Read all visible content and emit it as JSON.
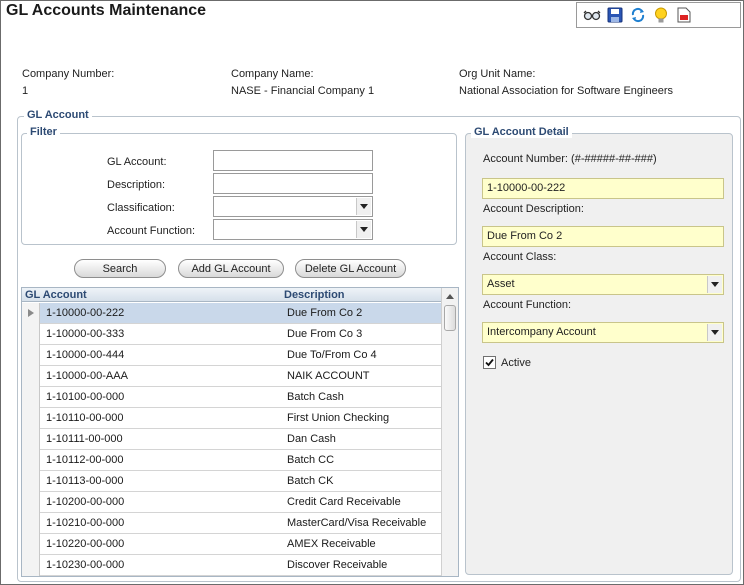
{
  "title": "GL Accounts Maintenance",
  "toolbar": {
    "icons": [
      "glasses-icon",
      "save-icon",
      "refresh-icon",
      "lightbulb-icon",
      "document-icon"
    ]
  },
  "company": {
    "number_label": "Company Number:",
    "number": "1",
    "name_label": "Company Name:",
    "name": "NASE - Financial Company 1",
    "org_label": "Org Unit Name:",
    "org": "National Association for Software Engineers"
  },
  "gl_account_group": "GL Account",
  "filter": {
    "legend": "Filter",
    "gl_account_label": "GL Account:",
    "gl_account_value": "",
    "description_label": "Description:",
    "description_value": "",
    "classification_label": "Classification:",
    "classification_value": "",
    "account_function_label": "Account Function:",
    "account_function_value": ""
  },
  "buttons": {
    "search": "Search",
    "add": "Add GL Account",
    "delete": "Delete GL Account"
  },
  "grid": {
    "columns": [
      "GL Account",
      "Description"
    ],
    "rows": [
      [
        "1-10000-00-222",
        "Due From Co 2"
      ],
      [
        "1-10000-00-333",
        "Due From Co 3"
      ],
      [
        "1-10000-00-444",
        "Due To/From Co 4"
      ],
      [
        "1-10000-00-AAA",
        "NAIK ACCOUNT"
      ],
      [
        "1-10100-00-000",
        "Batch Cash"
      ],
      [
        "1-10110-00-000",
        "First Union Checking"
      ],
      [
        "1-10111-00-000",
        "Dan Cash"
      ],
      [
        "1-10112-00-000",
        "Batch CC"
      ],
      [
        "1-10113-00-000",
        "Batch CK"
      ],
      [
        "1-10200-00-000",
        "Credit Card Receivable"
      ],
      [
        "1-10210-00-000",
        "MasterCard/Visa Receivable"
      ],
      [
        "1-10220-00-000",
        "AMEX Receivable"
      ],
      [
        "1-10230-00-000",
        "Discover Receivable"
      ]
    ],
    "selected_index": 0
  },
  "detail": {
    "legend": "GL Account Detail",
    "account_number_label": "Account Number: (#-#####-##-###)",
    "account_number": "1-10000-00-222",
    "description_label": "Account Description:",
    "description": "Due From Co 2",
    "class_label": "Account Class:",
    "class_value": "Asset",
    "function_label": "Account Function:",
    "function_value": "Intercompany Account",
    "active_label": "Active",
    "active": true
  },
  "colors": {
    "header_text": "#2d4a73",
    "selected_row": "#c9d8ea",
    "required_field": "#ffffcc"
  }
}
